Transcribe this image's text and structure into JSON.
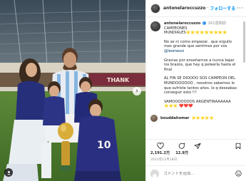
{
  "post": {
    "author": "antonelaroccuzzo",
    "follow_label": "フォローする",
    "more_label": "···",
    "photo": {
      "description_icons": [
        "tag-icon",
        "chevron-right-icon"
      ],
      "board_text": "THANK"
    }
  },
  "caption": {
    "username": "antonelaroccuzzo",
    "time": "161週間前",
    "title": "CAMPEONES MUNDIALES⭐⭐⭐⭐⭐⭐⭐⭐⭐",
    "p1_a": "No se ni como empezar.. que orgullo mas grande que sentimos por vos ",
    "p1_mention": "@leomessi",
    "p2": "Gracias por enseñarnos a nunca bajar los brazos, que hay q pelearla hasta el final",
    "p3": "AL FIN SE DIOOOO SOS CAMPEON DEL MUNDOOOOOO , nosotros sabemos lo que sufriste tantos años. lo q deseabas conseguir esto !!!",
    "p4": "VAMOOOOOOOS ARGENTINAAAAAA ⭐⭐⭐ ❤️❤️❤️"
  },
  "reply": {
    "username": "bouddahomar",
    "text": "⭐⭐⭐⭐⭐"
  },
  "actions": {
    "likes": "2,191.2万",
    "comments": "12.9万",
    "date": "2022年12月18日"
  },
  "comment_box": {
    "placeholder": "コメントを追加..."
  }
}
